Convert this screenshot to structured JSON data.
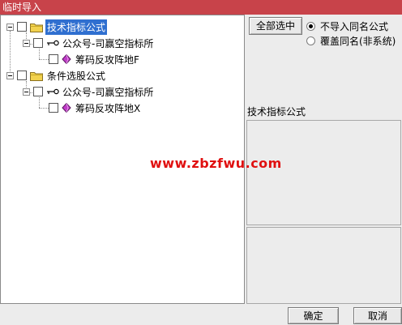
{
  "window": {
    "title": "临时导入"
  },
  "tree": {
    "nodes": [
      {
        "label": "技术指标公式",
        "type": "folder",
        "selected": true
      },
      {
        "label": "公众号-司赢空指标所",
        "type": "author"
      },
      {
        "label": "筹码反攻阵地F",
        "type": "formula"
      },
      {
        "label": "条件选股公式",
        "type": "folder",
        "selected": false
      },
      {
        "label": "公众号-司赢空指标所",
        "type": "author"
      },
      {
        "label": "筹码反攻阵地X",
        "type": "formula"
      }
    ]
  },
  "actions": {
    "select_all_label": "全部选中",
    "options": [
      {
        "label": "不导入同名公式",
        "checked": true
      },
      {
        "label": "覆盖同名(非系统)",
        "checked": false
      }
    ]
  },
  "description": {
    "section_title": "技术指标公式"
  },
  "watermark": "www.zbzfwu.com",
  "footer": {
    "ok_label": "确定",
    "cancel_label": "取消"
  }
}
